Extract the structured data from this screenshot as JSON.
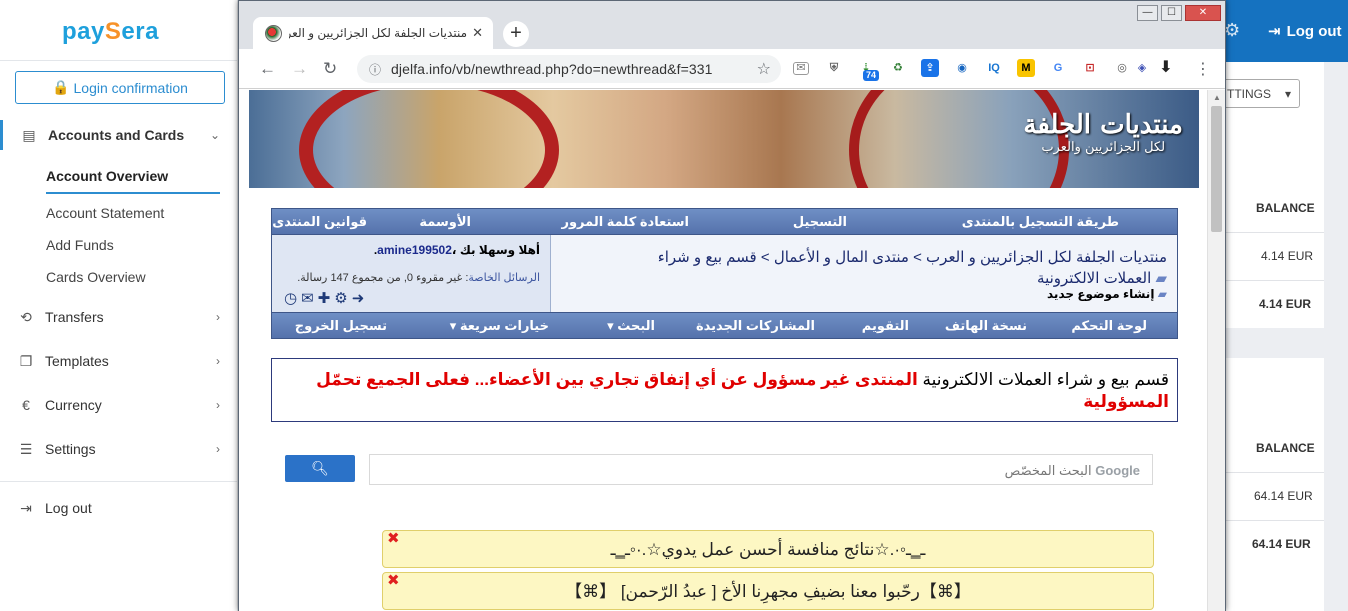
{
  "paysera": {
    "logo_left": "pay",
    "logo_mid": "S",
    "logo_right": "era",
    "login_confirmation": "Login confirmation",
    "nav": {
      "accounts_and_cards": "Accounts and Cards",
      "transfers": "Transfers",
      "templates": "Templates",
      "currency": "Currency",
      "settings": "Settings",
      "logout": "Log out"
    },
    "sub": {
      "account_overview": "Account Overview",
      "account_statement": "Account Statement",
      "add_funds": "Add Funds",
      "cards_overview": "Cards Overview"
    },
    "header_logout": "Log out",
    "settings_button": "TTINGS",
    "card1": {
      "balance_header": "BALANCE",
      "value": "4.14 EUR",
      "total": "4.14 EUR"
    },
    "card2": {
      "balance_header": "BALANCE",
      "value": "64.14 EUR",
      "total": "64.14 EUR"
    },
    "colors": {
      "brand_blue": "#1572c0",
      "accent": "#2c8dd0",
      "logo_orange": "#f79229"
    }
  },
  "browser": {
    "tab_title": "منتديات الجلفة لكل الجزائريين و العرب - إ...",
    "url": "djelfa.info/vb/newthread.php?do=newthread&f=331",
    "ext_badge": "74",
    "ext_iq": "IQ",
    "ext_m": "M"
  },
  "forum": {
    "banner_title": "منتديات الجلفة",
    "banner_subtitle": "لكل الجزائريين والعرب",
    "top_links": [
      "طريقة التسجيل بالمنتدى",
      "التسجيل",
      "استعادة كلمة المرور",
      "الأوسمة",
      "قوانين المنتدى"
    ],
    "welcome_prefix": "أهلا وسهلا بك",
    "username": "amine199502",
    "pm_label": "الرسائل الخاصة",
    "pm_text": ": غير مقروء 0, من مجموع 147 رسالة.",
    "breadcrumb_line1": "منتديات الجلفة لكل الجزائريين و العرب > منتدى المال و الأعمال > قسم بيع و شراء",
    "breadcrumb_line2": "العملات الالكترونية",
    "new_thread": "إنشاء موضوع جديد",
    "bottom_links": [
      "لوحة التحكم",
      "نسخة الهاتف",
      "التقويم",
      "المشاركات الجديدة",
      "البحث ▾",
      "خيارات سريعة ▾",
      "تسجيل الخروج"
    ],
    "notice_normal": "قسم بيع و شراء العملات الالكترونية ",
    "notice_red": "المنتدى غير مسؤول عن أي إتفاق تجاري بين الأعضاء... فعلى الجميع تحمّل المسؤولية",
    "search_brand": "Google",
    "search_placeholder": " البحث المخصّص",
    "note1": "ـ‗ـ◦·.☆نتائج منافسة أحسن عمل يدوي☆.·◦ـ‗ـ",
    "note2": "【⌘】رحّبوا معنا بضيفِ مجهرِنا الأخ [ عبدُ الرّحمن] 【⌘】"
  }
}
